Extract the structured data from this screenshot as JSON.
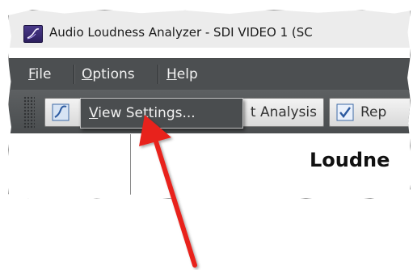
{
  "window": {
    "title": "Audio Loudness Analyzer - SDI VIDEO 1 (SC",
    "icon": "app-waveform-icon"
  },
  "menubar": {
    "items": [
      {
        "mnemonic": "F",
        "rest": "ile"
      },
      {
        "mnemonic": "O",
        "rest": "ptions"
      },
      {
        "mnemonic": "H",
        "rest": "elp"
      }
    ]
  },
  "toolbar": {
    "buttons": [
      {
        "label": "",
        "icon": "chart-icon"
      },
      {
        "label": "t Analysis",
        "icon": ""
      },
      {
        "label": "Rep",
        "icon": "report-check-icon"
      }
    ]
  },
  "dropdown": {
    "items": [
      {
        "mnemonic": "V",
        "rest": "iew Settings..."
      }
    ]
  },
  "content": {
    "title": "Loudne"
  },
  "annotation": {
    "arrow_color": "#e8221b"
  },
  "colors": {
    "menubar_bg": "#4c4f51",
    "titlebar_bg": "#ececec",
    "accent": "#e8221b"
  }
}
